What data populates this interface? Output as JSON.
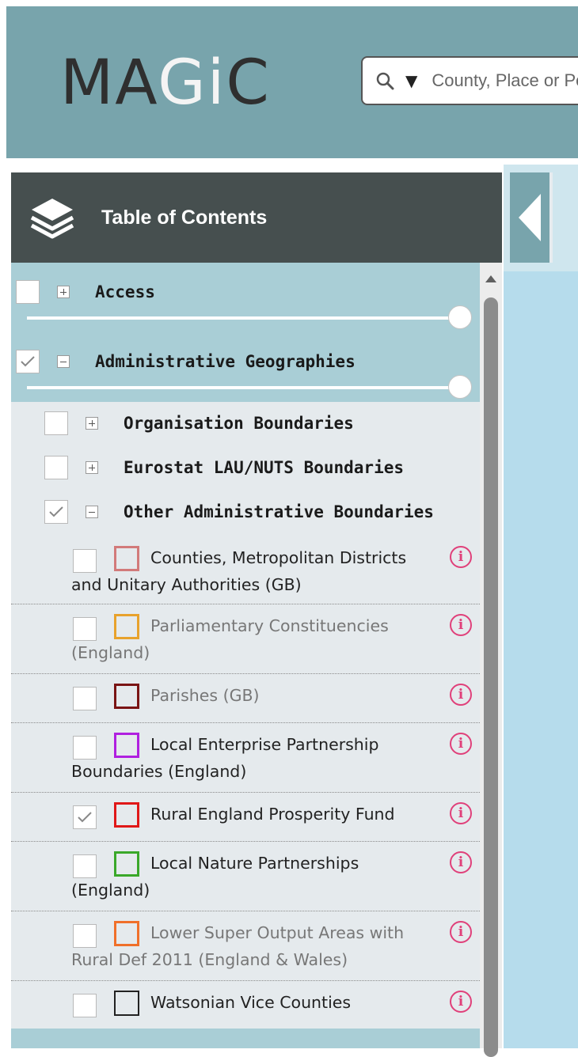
{
  "app": {
    "logo_part1": "MA",
    "logo_part2": "Gi",
    "logo_part3": "C"
  },
  "search": {
    "placeholder": "County, Place or Postcode",
    "dropdown_icon": "triangle-down",
    "icon": "search-icon"
  },
  "toc": {
    "title": "Table of Contents",
    "icon": "layers-icon",
    "collapse_icon": "chevron-left-icon"
  },
  "groups": [
    {
      "label": "Access",
      "checked": false,
      "expanded": false
    },
    {
      "label": "Administrative Geographies",
      "checked": true,
      "expanded": true
    }
  ],
  "subgroups": [
    {
      "label": "Organisation Boundaries",
      "checked": false,
      "expanded": false
    },
    {
      "label": "Eurostat LAU/NUTS Boundaries",
      "checked": false,
      "expanded": false
    },
    {
      "label": "Other Administrative Boundaries",
      "checked": true,
      "expanded": true
    }
  ],
  "layers": [
    {
      "label": "Counties, Metropolitan Districts and Unitary Authorities (GB)",
      "checked": false,
      "color": "#d27a7a",
      "active": true
    },
    {
      "label": "Parliamentary Constituencies (England)",
      "checked": false,
      "color": "#e8a22c",
      "active": false
    },
    {
      "label": "Parishes (GB)",
      "checked": false,
      "color": "#7a1414",
      "active": false
    },
    {
      "label": "Local Enterprise Partnership Boundaries (England)",
      "checked": false,
      "color": "#b020e0",
      "active": true
    },
    {
      "label": "Rural England Prosperity Fund",
      "checked": true,
      "color": "#e01818",
      "active": true
    },
    {
      "label": "Local Nature Partnerships (England)",
      "checked": false,
      "color": "#3aa82a",
      "active": true
    },
    {
      "label": "Lower Super Output Areas with Rural Def 2011 (England & Wales)",
      "checked": false,
      "color": "#f0702a",
      "active": false
    },
    {
      "label": "Watsonian Vice Counties",
      "checked": false,
      "color": "#222222",
      "active": true
    }
  ],
  "info_glyph": "i"
}
